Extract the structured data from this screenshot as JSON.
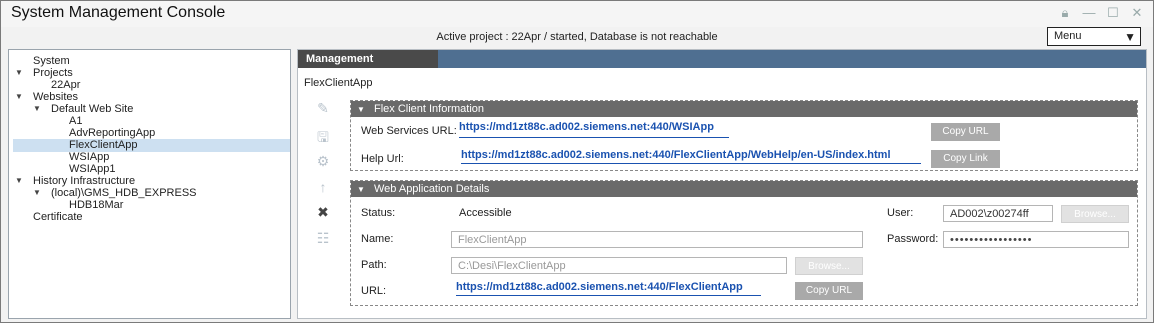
{
  "window": {
    "title": "System Management Console",
    "controls": [
      "lock-icon",
      "minimize-icon",
      "maximize-icon",
      "close-icon"
    ]
  },
  "status": "Active project : 22Apr / started, Database is not reachable",
  "menu": {
    "selected": "Menu"
  },
  "tree": {
    "system": "System",
    "projects": "Projects",
    "project_22apr": "22Apr",
    "websites": "Websites",
    "default_web_site": "Default Web Site",
    "a1": "A1",
    "advreportingapp": "AdvReportingApp",
    "flexclientapp": "FlexClientApp",
    "wsiapp": "WSIApp",
    "wsiapp1": "WSIApp1",
    "history_infrastructure": "History Infrastructure",
    "local_gms": "(local)\\GMS_HDB_EXPRESS",
    "hdb18mar": "HDB18Mar",
    "certificate": "Certificate"
  },
  "main": {
    "tab": "Management",
    "page_title": "FlexClientApp"
  },
  "toolbar": [
    "edit-icon",
    "save-icon",
    "group-icon",
    "up-arrow-icon",
    "delete-icon",
    "tree-icon"
  ],
  "flex_client": {
    "header": "Flex Client Information",
    "web_services_label": "Web Services URL:",
    "web_services_url": "https://md1zt88c.ad002.siemens.net:440/WSIApp",
    "copy_url_label": "Copy URL",
    "help_url_label": "Help Url:",
    "help_url": "https://md1zt88c.ad002.siemens.net:440/FlexClientApp/WebHelp/en-US/index.html",
    "copy_link_label": "Copy Link"
  },
  "web_app": {
    "header": "Web Application Details",
    "status_label": "Status:",
    "status_value": "Accessible",
    "name_label": "Name:",
    "name_value": "FlexClientApp",
    "path_label": "Path:",
    "path_value": "C:\\Desi\\FlexClientApp",
    "path_browse": "Browse...",
    "url_label": "URL:",
    "url_value": "https://md1zt88c.ad002.siemens.net:440/FlexClientApp",
    "copy_url_label": "Copy URL",
    "user_label": "User:",
    "user_value": "AD002\\z00274ff",
    "user_browse": "Browse...",
    "password_label": "Password:",
    "password_value": "•••••••••••••••••"
  }
}
